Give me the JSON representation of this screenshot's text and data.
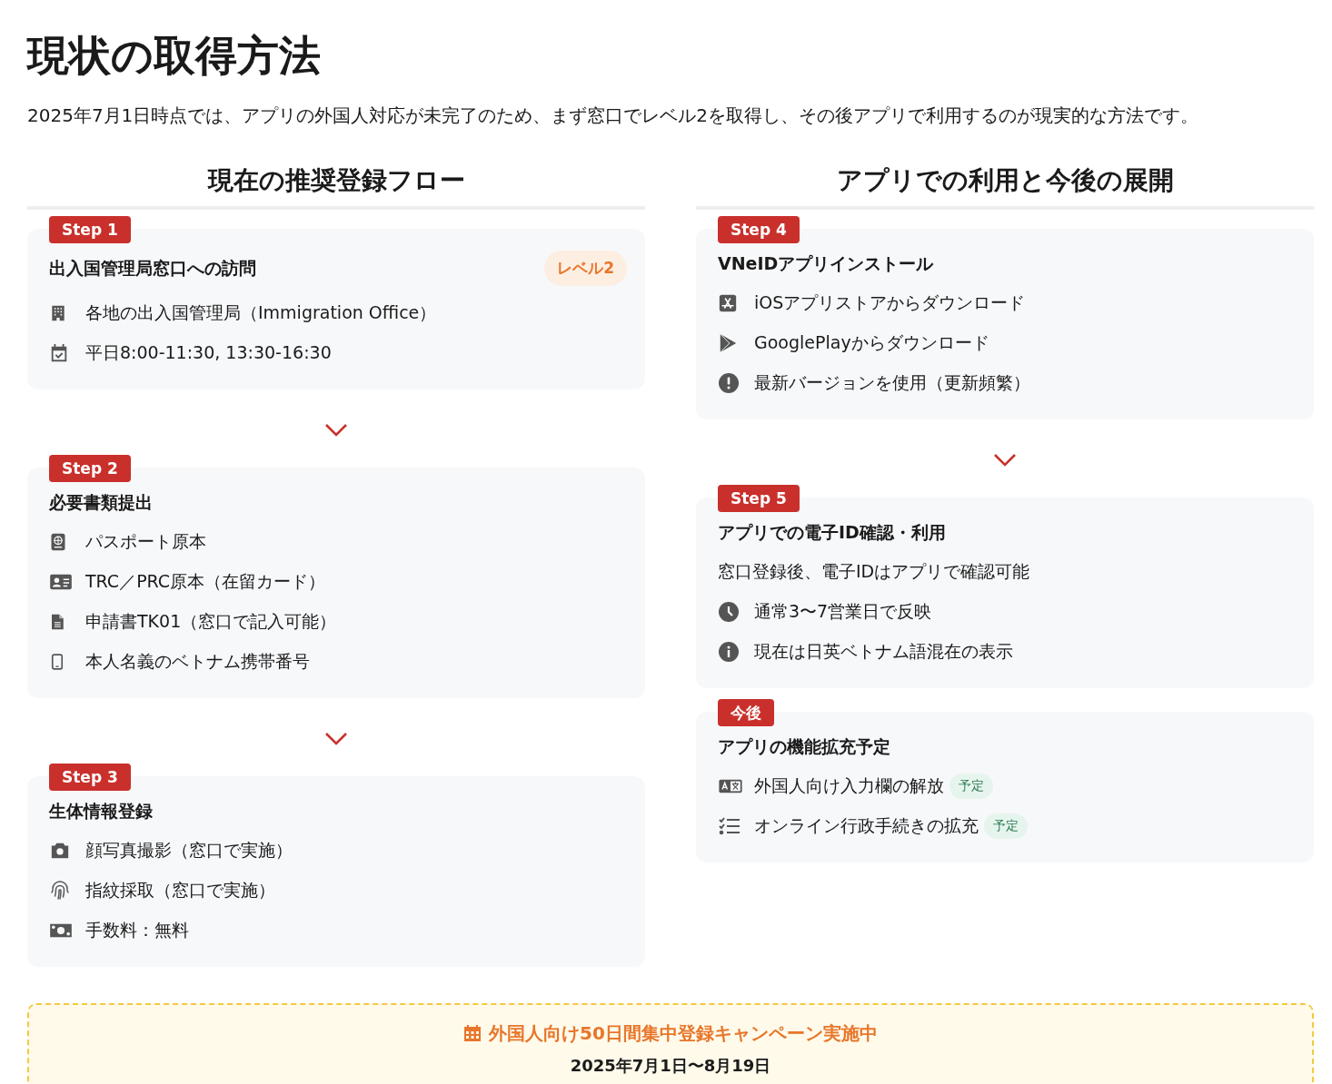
{
  "page": {
    "title": "現状の取得方法",
    "lead": "2025年7月1日時点では、アプリの外国人対応が未完了のため、まず窓口でレベル2を取得し、その後アプリで利用するのが現実的な方法です。"
  },
  "columns": [
    {
      "heading": "現在の推奨登録フロー",
      "cards": [
        {
          "badge": "Step 1",
          "title": "出入国管理局窓口への訪問",
          "level_tag": "レベル2",
          "connected": true,
          "items": [
            {
              "kind": "icon",
              "text": "各地の出入国管理局（Immigration Office）"
            },
            {
              "kind": "icon",
              "text": "平日8:00-11:30, 13:30-16:30"
            }
          ]
        },
        {
          "badge": "Step 2",
          "title": "必要書類提出",
          "connected": true,
          "items": [
            {
              "kind": "icon",
              "text": "パスポート原本"
            },
            {
              "kind": "icon",
              "text": "TRC／PRC原本（在留カード）"
            },
            {
              "kind": "icon",
              "text": "申請書TK01（窓口で記入可能）"
            },
            {
              "kind": "icon",
              "text": "本人名義のベトナム携帯番号"
            }
          ]
        },
        {
          "badge": "Step 3",
          "title": "生体情報登録",
          "connected": false,
          "items": [
            {
              "kind": "icon",
              "text": "顔写真撮影（窓口で実施）"
            },
            {
              "kind": "icon",
              "text": "指紋採取（窓口で実施）"
            },
            {
              "kind": "icon",
              "text": "手数料：無料"
            }
          ]
        }
      ]
    },
    {
      "heading": "アプリでの利用と今後の展開",
      "cards": [
        {
          "badge": "Step 4",
          "title": "VNeIDアプリインストール",
          "connected": true,
          "items": [
            {
              "kind": "icon",
              "text": "iOSアプリストアからダウンロード"
            },
            {
              "kind": "icon",
              "text": "GooglePlayからダウンロード"
            },
            {
              "kind": "icon",
              "text": "最新バージョンを使用（更新頻繁）"
            }
          ]
        },
        {
          "badge": "Step 5",
          "title": "アプリでの電子ID確認・利用",
          "connected": false,
          "items": [
            {
              "kind": "note",
              "text": "窓口登録後、電子IDはアプリで確認可能"
            },
            {
              "kind": "icon",
              "text": "通常3〜7営業日で反映"
            },
            {
              "kind": "icon",
              "text": "現在は日英ベトナム語混在の表示"
            }
          ]
        },
        {
          "badge": "今後",
          "title": "アプリの機能拡充予定",
          "connected": false,
          "items": [
            {
              "kind": "icon",
              "text": "外国人向け入力欄の解放",
              "tag": "予定"
            },
            {
              "kind": "icon",
              "text": "オンライン行政手続きの拡充",
              "tag": "予定"
            }
          ]
        }
      ]
    }
  ],
  "banner": {
    "title": "外国人向け50日間集中登録キャンペーン実施中",
    "date": "2025年7月1日〜8月19日"
  }
}
